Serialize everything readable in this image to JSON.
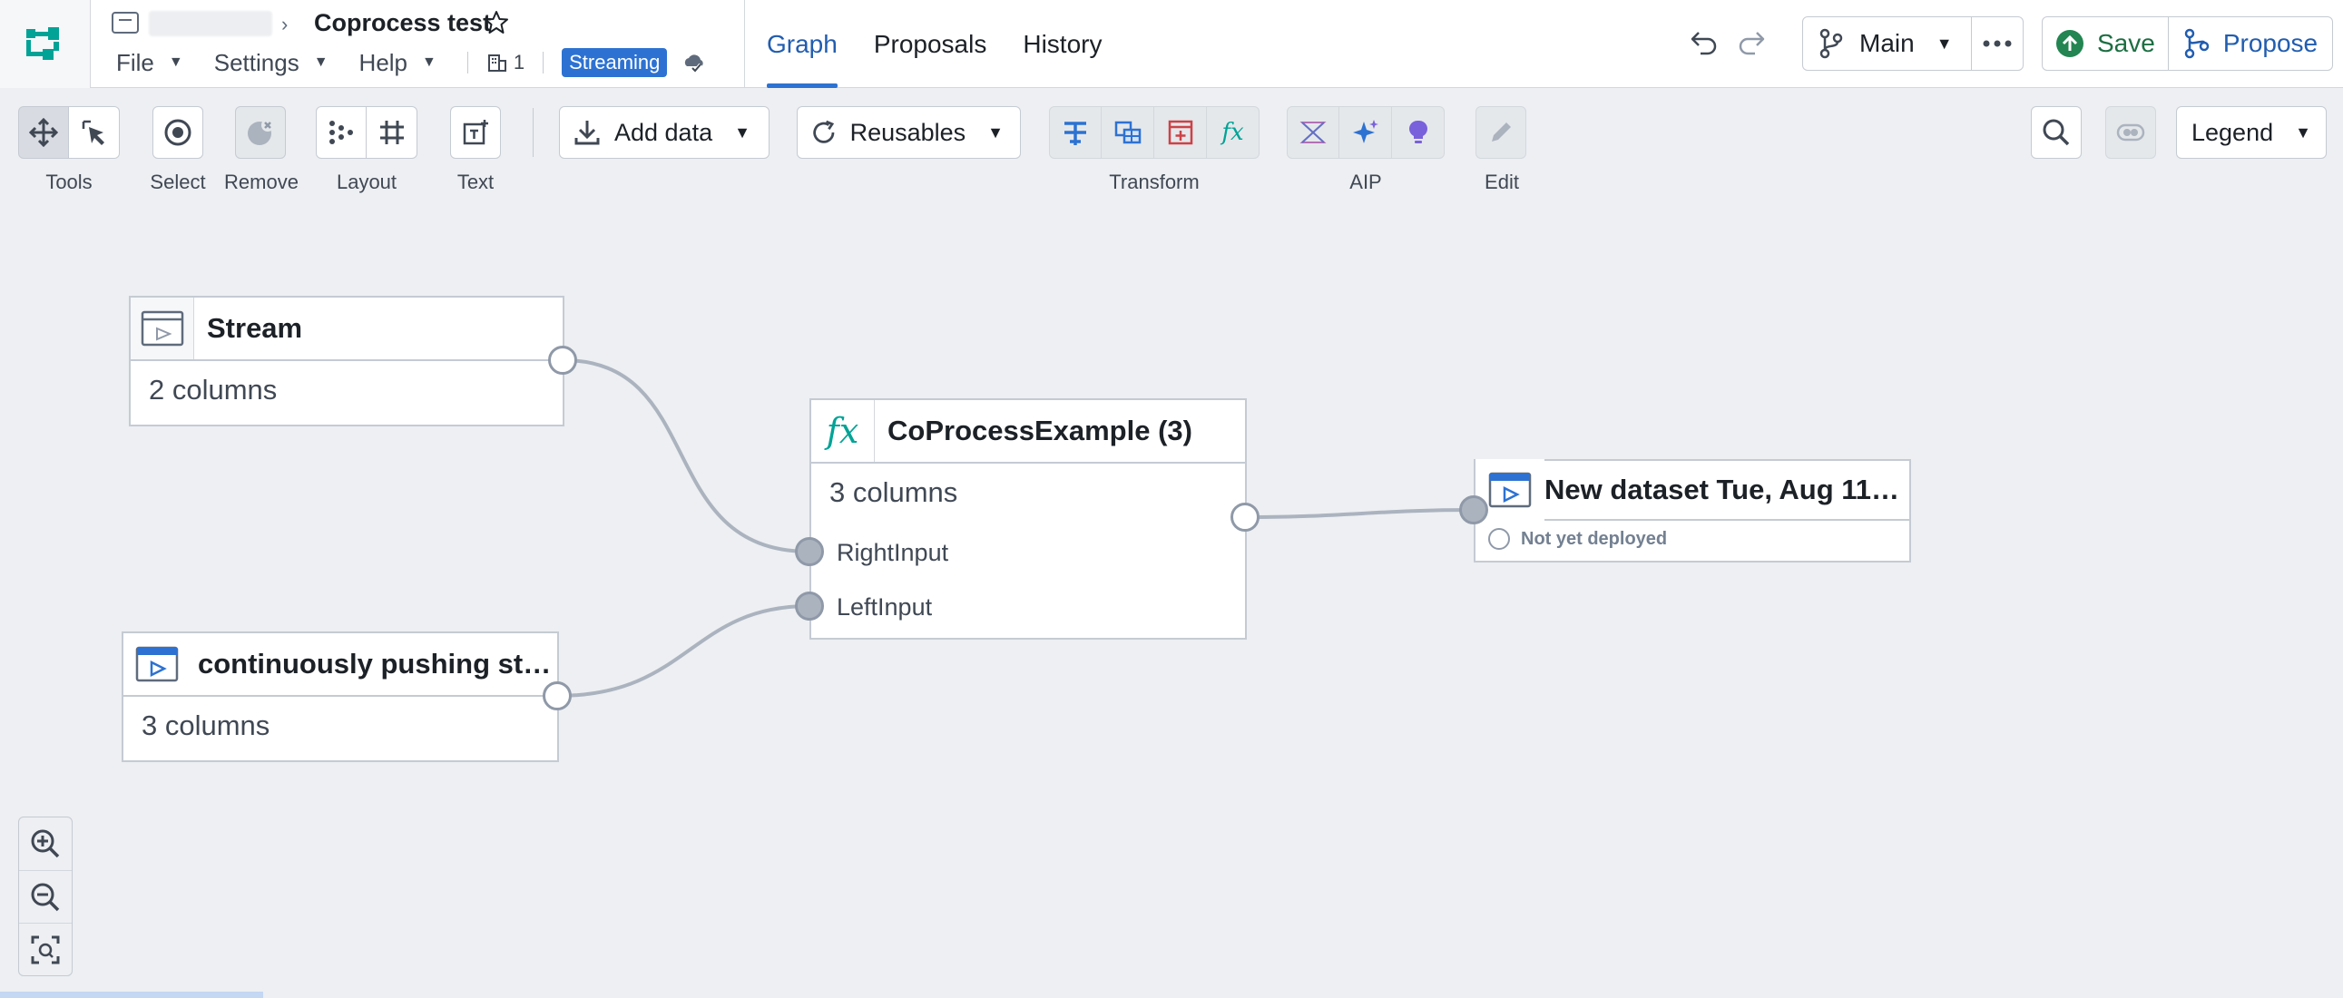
{
  "header": {
    "doc_title": "Coprocess test",
    "menus": [
      "File",
      "Settings",
      "Help"
    ],
    "building_count": "1",
    "streaming_label": "Streaming",
    "tabs": [
      "Graph",
      "Proposals",
      "History"
    ],
    "active_tab": "Graph",
    "branch": "Main",
    "save_label": "Save",
    "propose_label": "Propose"
  },
  "toolbar": {
    "tools_label": "Tools",
    "select_label": "Select",
    "remove_label": "Remove",
    "layout_label": "Layout",
    "text_label": "Text",
    "add_data": "Add data",
    "reusables": "Reusables",
    "transform_label": "Transform",
    "aip_label": "AIP",
    "edit_label": "Edit",
    "legend": "Legend"
  },
  "graph": {
    "stream_node": {
      "title": "Stream",
      "columns": "2 columns"
    },
    "pushing_node": {
      "title": "continuously pushing str…",
      "columns": "3 columns"
    },
    "transform_node": {
      "title": "CoProcessExample (3)",
      "columns": "3 columns",
      "inputs": [
        "RightInput",
        "LeftInput"
      ]
    },
    "output_node": {
      "title": "New dataset Tue, Aug 11,…",
      "status": "Not yet deployed"
    }
  },
  "colors": {
    "accent": "#2d72d2",
    "save_green": "#1c6e42",
    "canvas_bg": "#edeff2",
    "transform_fx": "#00a396"
  }
}
